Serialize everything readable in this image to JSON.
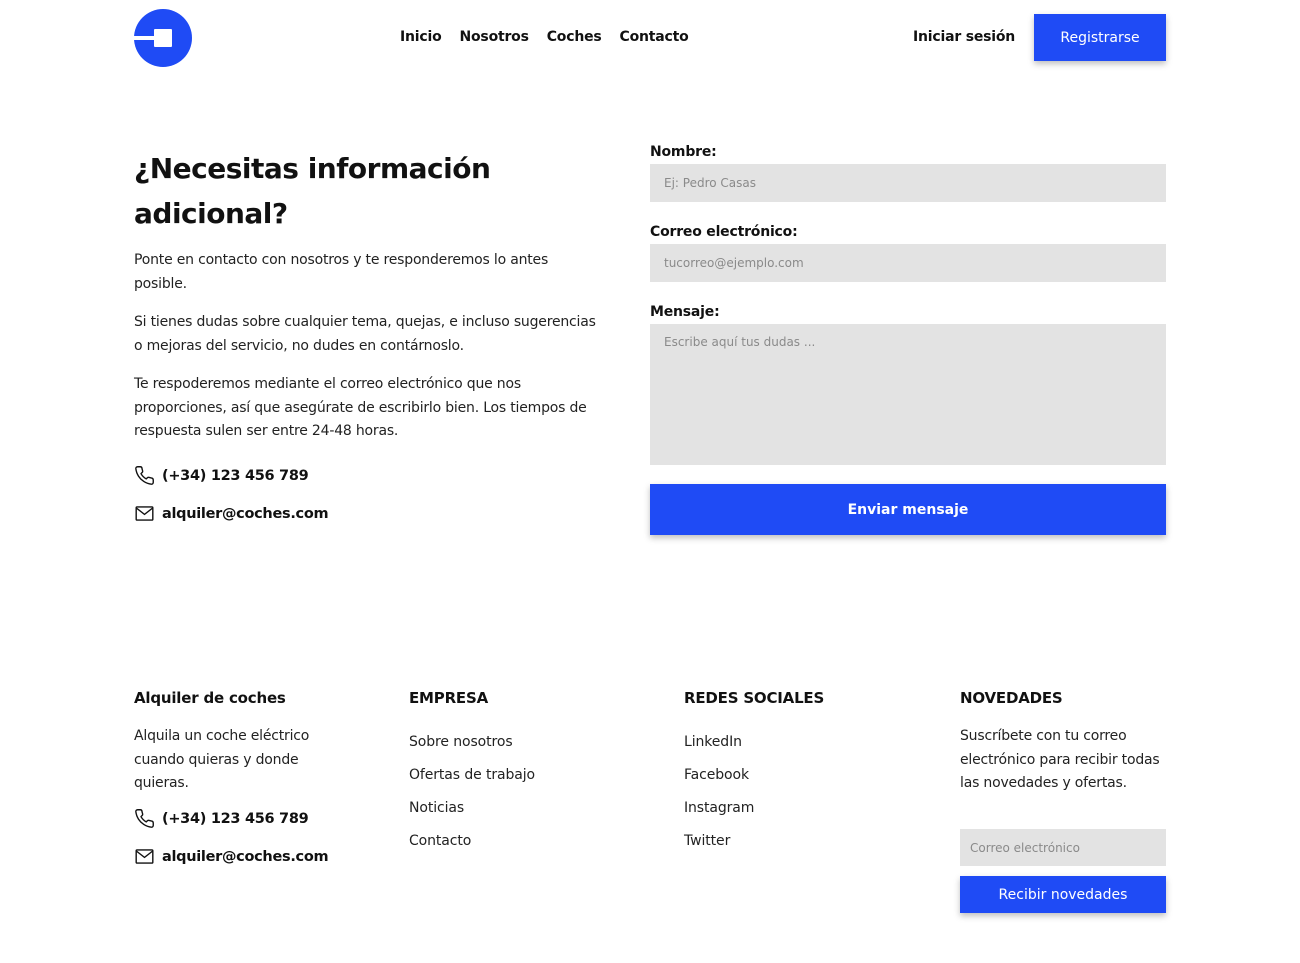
{
  "brand": {
    "accent": "#1f4bf5",
    "logo_icon": "logo-icon"
  },
  "nav": {
    "items": [
      {
        "label": "Inicio"
      },
      {
        "label": "Nosotros"
      },
      {
        "label": "Coches"
      },
      {
        "label": "Contacto"
      }
    ]
  },
  "header": {
    "login_label": "Iniciar sesión",
    "register_label": "Registrarse"
  },
  "intro": {
    "title": "¿Necesitas información adicional?",
    "paragraphs": [
      "Ponte en contacto con nosotros y te responderemos lo antes posible.",
      "Si tienes dudas sobre cualquier tema, quejas, e incluso sugerencias o mejoras del servicio, no dudes en contárnoslo.",
      "Te respoderemos mediante el correo electrónico que nos proporciones, así que asegúrate de escribirlo bien. Los tiempos de respuesta sulen ser entre 24-48 horas."
    ],
    "phone": "(+34) 123 456 789",
    "email": "alquiler@coches.com"
  },
  "form": {
    "name_label": "Nombre:",
    "name_placeholder": "Ej: Pedro Casas",
    "email_label": "Correo electrónico:",
    "email_placeholder": "tucorreo@ejemplo.com",
    "message_label": "Mensaje:",
    "message_placeholder": "Escribe aquí tus dudas ...",
    "submit_label": "Enviar mensaje"
  },
  "footer": {
    "company": {
      "heading": "Alquiler de coches",
      "description": "Alquila un coche eléctrico cuando quieras y donde quieras.",
      "phone": "(+34) 123 456 789",
      "email": "alquiler@coches.com"
    },
    "empresa": {
      "heading": "EMPRESA",
      "links": [
        "Sobre nosotros",
        "Ofertas de trabajo",
        "Noticias",
        "Contacto"
      ]
    },
    "social": {
      "heading": "REDES SOCIALES",
      "links": [
        "LinkedIn",
        "Facebook",
        "Instagram",
        "Twitter"
      ]
    },
    "newsletter": {
      "heading": "NOVEDADES",
      "description": "Suscríbete con tu correo electrónico para recibir todas las novedades y ofertas.",
      "placeholder": "Correo electrónico",
      "button_label": "Recibir novedades"
    }
  }
}
